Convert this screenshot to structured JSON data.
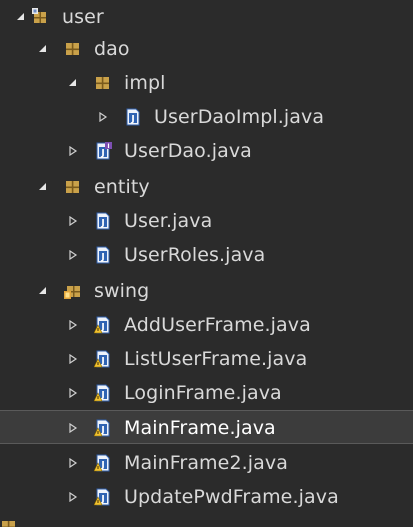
{
  "colors": {
    "background": "#2b2b2b",
    "selection": "#3c3c3c",
    "text": "#d9d9d9",
    "package_icon": "#c9a14a",
    "java_icon": "#3a6fb5"
  },
  "tree": {
    "items": [
      {
        "label": "user",
        "icon": "project-package-icon",
        "expanded": true
      },
      {
        "label": "dao",
        "icon": "package-icon",
        "expanded": true
      },
      {
        "label": "impl",
        "icon": "package-icon",
        "expanded": true
      },
      {
        "label": "UserDaoImpl.java",
        "icon": "java-class-file-icon",
        "expanded": false
      },
      {
        "label": "UserDao.java",
        "icon": "java-interface-file-icon",
        "expanded": false
      },
      {
        "label": "entity",
        "icon": "package-icon",
        "expanded": true
      },
      {
        "label": "User.java",
        "icon": "java-class-file-icon",
        "expanded": false
      },
      {
        "label": "UserRoles.java",
        "icon": "java-class-file-icon",
        "expanded": false
      },
      {
        "label": "swing",
        "icon": "project-package-icon",
        "expanded": true
      },
      {
        "label": "AddUserFrame.java",
        "icon": "java-class-file-warning-icon",
        "expanded": false
      },
      {
        "label": "ListUserFrame.java",
        "icon": "java-class-file-warning-icon",
        "expanded": false
      },
      {
        "label": "LoginFrame.java",
        "icon": "java-class-file-warning-icon",
        "expanded": false
      },
      {
        "label": "MainFrame.java",
        "icon": "java-class-file-warning-icon",
        "expanded": false,
        "selected": true
      },
      {
        "label": "MainFrame2.java",
        "icon": "java-class-file-warning-icon",
        "expanded": false
      },
      {
        "label": "UpdatePwdFrame.java",
        "icon": "java-class-file-warning-icon",
        "expanded": false
      }
    ]
  }
}
